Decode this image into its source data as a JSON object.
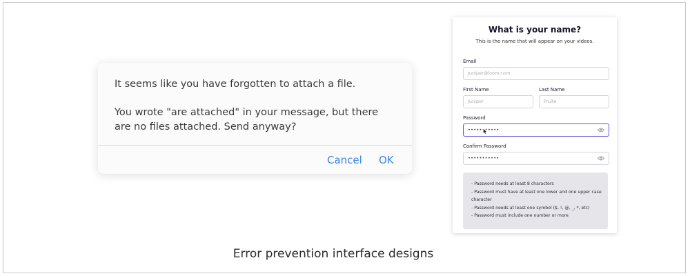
{
  "dialog": {
    "message_1": "It seems like you have forgotten to attach a file.",
    "message_2": "You wrote \"are attached\" in your message, but there are no files attached. Send anyway?",
    "cancel_label": "Cancel",
    "ok_label": "OK",
    "accent_color": "#3a86e8"
  },
  "form": {
    "title": "What is your name?",
    "subtitle": "This is the name that will appear on your videos.",
    "email_label": "Email",
    "email_placeholder": "Juniper@loom.com",
    "first_name_label": "First Name",
    "first_name_placeholder": "Juniper",
    "last_name_label": "Last Name",
    "last_name_placeholder": "Fruite",
    "password_label": "Password",
    "password_value": "•••••••••••",
    "confirm_password_label": "Confirm Password",
    "confirm_password_value": "•••••••••••",
    "eye_icon": "eye-icon",
    "focus_color": "#5b54d8",
    "rules": [
      "- Password needs at least 8 characters",
      "- Password must have at least one lower and one upper case character",
      "- Password needs at least one symbol ($, !, @, _, *, etc)",
      "- Password must include one number or more"
    ]
  },
  "caption": "Error prevention interface designs"
}
